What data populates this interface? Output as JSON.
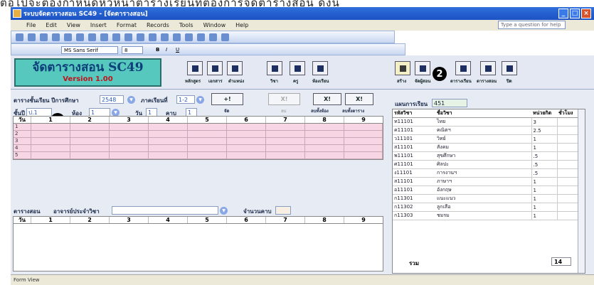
{
  "page_text_top": "ต่อไปจะต้องกำหนดหัวหน้าตารางเรียนที่ต้องการจัดตารางสอน ดังนี้",
  "window": {
    "title": "ระบบจัดตารางสอน SC49 - [จัดตารางสอน]",
    "help_placeholder": "Type a question for help"
  },
  "menu": [
    "File",
    "Edit",
    "View",
    "Insert",
    "Format",
    "Records",
    "Tools",
    "Window",
    "Help"
  ],
  "format_bar": {
    "font": "MS Sans Serif",
    "size": "8",
    "bold": "B",
    "italic": "I",
    "underline": "U"
  },
  "logo": {
    "title": "จัดตารางสอน SC49",
    "version": "Version 1.00"
  },
  "header_buttons": {
    "group1": [
      "หลักสูตร",
      "เอกสาร",
      "ตำแหน่ง"
    ],
    "group2": [
      "วิชา",
      "ครู",
      "ห้องเรียน"
    ],
    "group3": [
      "สร้าง",
      "จัดผู้สอน"
    ],
    "group4": [
      "ตารางเรียน",
      "ตารางสอน",
      "ปิด"
    ]
  },
  "markers": {
    "one": "1",
    "two": "2"
  },
  "filters": {
    "table_label": "ตารางชั้นเรียน ปีการศึกษา",
    "year": "2548",
    "semester_label": "ภาคเรียนที่",
    "semester": "1-2",
    "class_label": "ชั้นปี",
    "class_value": "ป.1",
    "room_label": "ห้อง",
    "room_value": "1",
    "day_label": "วัน",
    "day_value": "1",
    "period_label": "คาบ",
    "period_value": "1"
  },
  "action_buttons": [
    {
      "icon": "+!",
      "label": "จัด"
    },
    {
      "icon": "X!",
      "label": "ลบ"
    },
    {
      "icon": "X!",
      "label": "ลบทั้งห้อง"
    },
    {
      "icon": "X!",
      "label": "ลบทั้งตาราง"
    }
  ],
  "class_grid": {
    "headers": [
      "วัน",
      "1",
      "2",
      "3",
      "4",
      "5",
      "6",
      "7",
      "8",
      "9"
    ],
    "rows": [
      "1",
      "2",
      "3",
      "4",
      "5"
    ]
  },
  "teacher_section": {
    "label": "ตารางสอน",
    "teacher_label": "อาจารย์ประจำวิชา",
    "teacher_value": "",
    "periods_label": "จำนวนคาบ",
    "periods_value": "",
    "headers": [
      "วัน",
      "1",
      "2",
      "3",
      "4",
      "5",
      "6",
      "7",
      "8",
      "9"
    ]
  },
  "subjects": {
    "plan_label": "แผนการเรียน",
    "plan_value": "451",
    "headers": [
      "รหัสวิชา",
      "ชื่อวิชา",
      "หน่วยกิต",
      "ชั่วโมง"
    ],
    "rows": [
      [
        "ท11101",
        "ไทย",
        "3",
        ""
      ],
      [
        "ค11101",
        "คณิตฯ",
        "2.5",
        ""
      ],
      [
        "ว11101",
        "วิทย์",
        "1",
        ""
      ],
      [
        "ส11101",
        "สังคม",
        "1",
        ""
      ],
      [
        "พ11101",
        "สุขศึกษา",
        ".5",
        ""
      ],
      [
        "ศ11101",
        "ศิลปะ",
        ".5",
        ""
      ],
      [
        "ง11101",
        "การงานฯ",
        ".5",
        ""
      ],
      [
        "ส11101",
        "ภาษาฯ",
        "1",
        ""
      ],
      [
        "อ11101",
        "อังกฤษ",
        "1",
        ""
      ],
      [
        "ก11301",
        "แนะแนว",
        "1",
        ""
      ],
      [
        "ก11302",
        "ลูกเสือ",
        "1",
        ""
      ],
      [
        "ก11303",
        "ชมรม",
        "1",
        ""
      ]
    ],
    "total_label": "รวม",
    "total_value": "14"
  },
  "status": "Form View"
}
